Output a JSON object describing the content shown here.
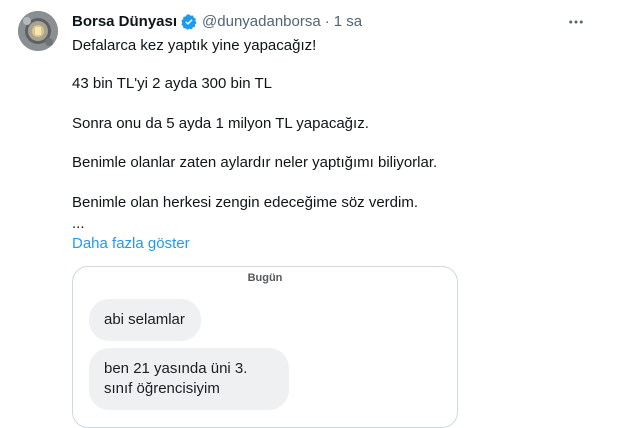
{
  "tweet": {
    "author": {
      "display_name": "Borsa Dünyası",
      "handle": "@dunyadanborsa",
      "separator": "·",
      "time": "1 sa"
    },
    "lines": [
      "Defalarca kez yaptık yine yapacağız!",
      "43 bin TL'yi 2 ayda 300 bin TL",
      "Sonra onu da 5 ayda 1 milyon TL yapacağız.",
      "Benimle olanlar zaten aylardır neler yaptığımı biliyorlar.",
      "Benimle olan herkesi zengin edeceğime söz verdim.",
      "..."
    ],
    "show_more": "Daha fazla göster",
    "media": {
      "date_label": "Bugün",
      "messages": [
        "abi selamlar",
        "ben 21 yasında üni 3. sınıf öğrencisiyim"
      ]
    }
  },
  "colors": {
    "verified_badge": "#1d9bf0",
    "link": "#1d9bf0",
    "secondary_text": "#536471",
    "bubble": "#eef0f2"
  },
  "icons": {
    "verified": "verified-badge-icon",
    "more": "more-horizontal-icon"
  }
}
